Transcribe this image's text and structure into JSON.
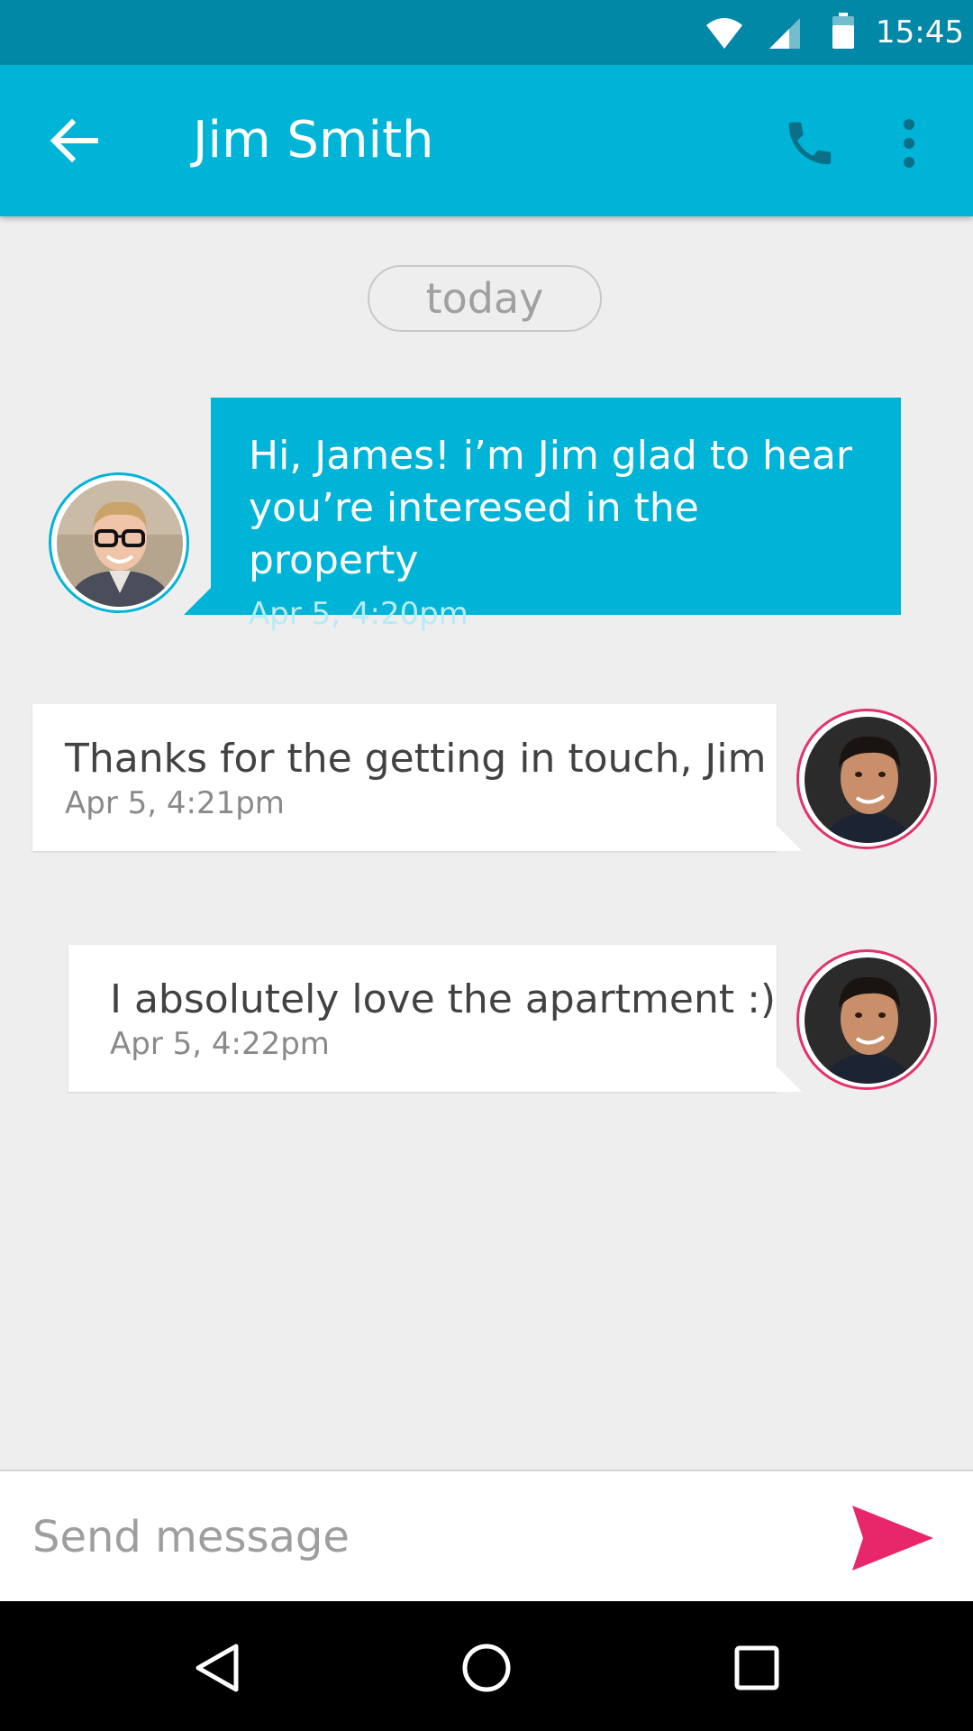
{
  "status_bar": {
    "time": "15:45",
    "icons": [
      "wifi-icon",
      "cellular-signal-icon",
      "battery-icon"
    ]
  },
  "app_bar": {
    "title": "Jim Smith",
    "back_icon": "arrow-back-icon",
    "call_icon": "phone-icon",
    "menu_icon": "more-vert-icon"
  },
  "date_divider": "today",
  "messages": [
    {
      "direction": "outgoing",
      "text": "Hi, James! i’m Jim glad to hear you’re interesed in the property",
      "timestamp": "Apr 5, 4:20pm"
    },
    {
      "direction": "incoming",
      "text": "Thanks for the getting in touch, Jim",
      "timestamp": "Apr 5, 4:21pm"
    },
    {
      "direction": "incoming",
      "text": "I absolutely love the apartment :)",
      "timestamp": "Apr 5, 4:22pm"
    }
  ],
  "composer": {
    "placeholder": "Send message",
    "value": "",
    "send_icon": "send-icon"
  },
  "nav_bar": {
    "icons": [
      "nav-back-icon",
      "nav-home-icon",
      "nav-recents-icon"
    ]
  },
  "colors": {
    "status_bar": "#0288a7",
    "app_bar": "#00b4d8",
    "outgoing_bubble": "#00b4d8",
    "incoming_bubble": "#ffffff",
    "accent": "#e8266a",
    "background": "#eeeeee"
  }
}
